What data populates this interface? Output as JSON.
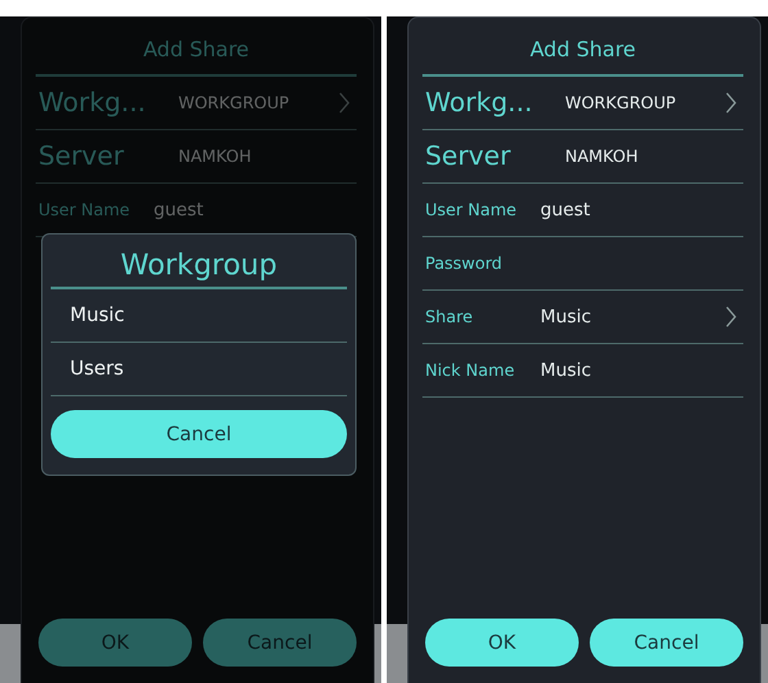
{
  "screens": [
    {
      "dimmed": true,
      "dialog": {
        "title": "Add Share",
        "rows": [
          {
            "kind": "large",
            "label": "Workg...",
            "value": "WORKGROUP",
            "chevron": true
          },
          {
            "kind": "large",
            "label": "Server",
            "value": "NAMKOH",
            "chevron": false
          },
          {
            "kind": "small",
            "label": "User Name",
            "value": "guest",
            "chevron": false
          }
        ],
        "buttons": [
          "OK",
          "Cancel"
        ]
      },
      "picker": {
        "title": "Workgroup",
        "options": [
          "Music",
          "Users"
        ],
        "cancel": "Cancel"
      }
    },
    {
      "dimmed": false,
      "dialog": {
        "title": "Add Share",
        "rows": [
          {
            "kind": "large",
            "label": "Workg...",
            "value": "WORKGROUP",
            "chevron": true
          },
          {
            "kind": "large",
            "label": "Server",
            "value": "NAMKOH",
            "chevron": false
          },
          {
            "kind": "small",
            "label": "User Name",
            "value": "guest",
            "chevron": false
          },
          {
            "kind": "small",
            "label": "Password",
            "value": "",
            "chevron": false
          },
          {
            "kind": "small",
            "label": "Share",
            "value": "Music",
            "chevron": true
          },
          {
            "kind": "small",
            "label": "Nick Name",
            "value": "Music",
            "chevron": false
          }
        ],
        "buttons": [
          "OK",
          "Cancel"
        ]
      }
    }
  ]
}
